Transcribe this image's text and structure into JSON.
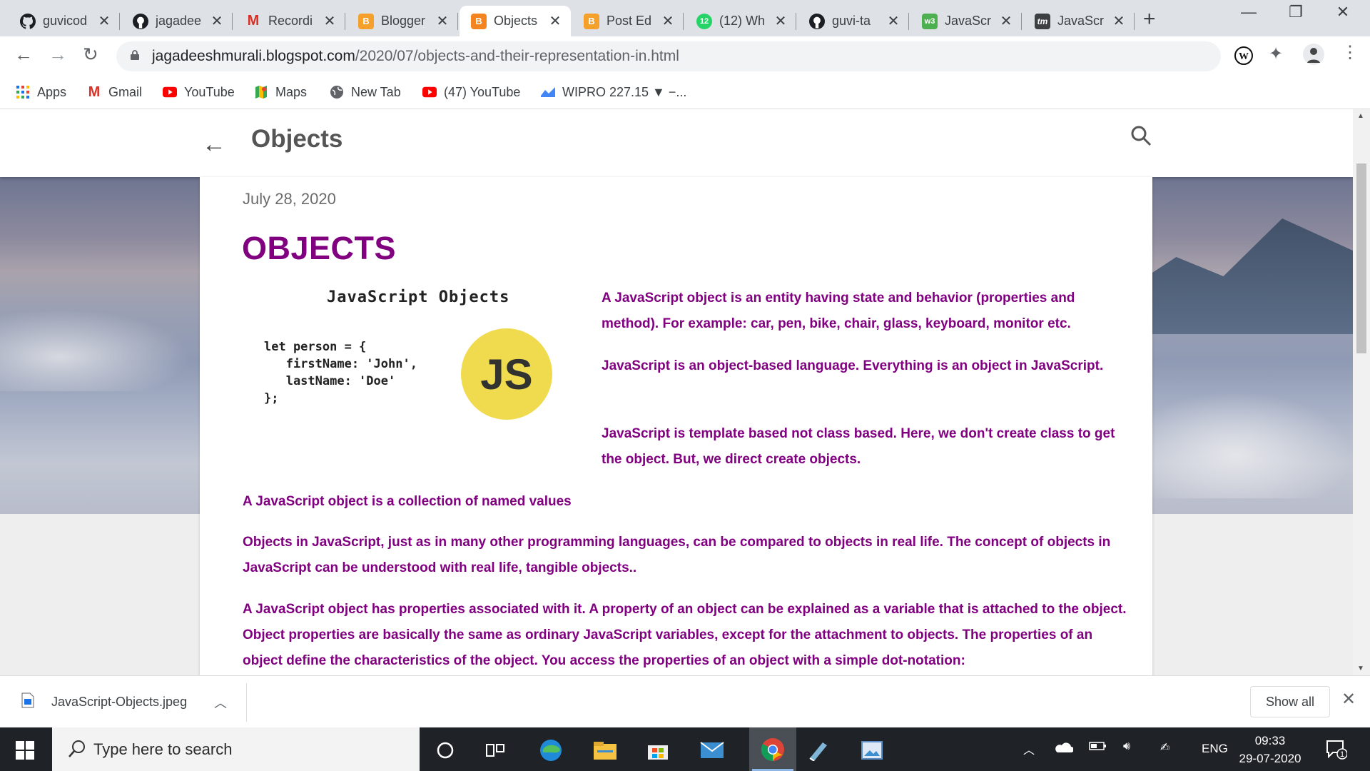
{
  "browser": {
    "tabs": [
      {
        "title": "guvicod",
        "icon": "github-icon",
        "active": false
      },
      {
        "title": "jagadee",
        "icon": "github-icon",
        "active": false
      },
      {
        "title": "Recordi",
        "icon": "gmail-icon",
        "active": false
      },
      {
        "title": "Blogger",
        "icon": "blogger-icon",
        "active": false
      },
      {
        "title": "Objects",
        "icon": "blogger-icon",
        "active": true
      },
      {
        "title": "Post Ed",
        "icon": "blogger-icon",
        "active": false
      },
      {
        "title": "(12) Wh",
        "icon": "whatsapp-icon",
        "badge": "12",
        "active": false
      },
      {
        "title": "guvi-ta",
        "icon": "github-icon",
        "active": false
      },
      {
        "title": "JavaScr",
        "icon": "w3schools-icon",
        "badge": "w3",
        "active": false
      },
      {
        "title": "JavaScr",
        "icon": "tutorialsmate-icon",
        "badge": "tm",
        "active": false
      }
    ],
    "url_domain": "jagadeeshmurali.blogspot.com",
    "url_path": "/2020/07/objects-and-their-representation-in.html",
    "bookmarks": [
      {
        "label": "Apps",
        "icon": "apps-grid-icon"
      },
      {
        "label": "Gmail",
        "icon": "gmail-icon"
      },
      {
        "label": "YouTube",
        "icon": "youtube-icon"
      },
      {
        "label": "Maps",
        "icon": "maps-icon"
      },
      {
        "label": "New Tab",
        "icon": "globe-icon"
      },
      {
        "label": "(47) YouTube",
        "icon": "youtube-icon"
      },
      {
        "label": "WIPRO 227.15 ▼ −...",
        "icon": "stock-icon"
      }
    ]
  },
  "blog": {
    "header_title": "Objects",
    "date": "July 28, 2020",
    "heading": "OBJECTS",
    "figure": {
      "title": "JavaScript Objects",
      "code": "let person = {\n   firstName: 'John',\n   lastName: 'Doe'\n};",
      "logo_text": "JS"
    },
    "paragraphs": [
      "A JavaScript object is an entity having state and behavior (properties and method). For example: car, pen, bike, chair, glass, keyboard, monitor etc.",
      "JavaScript is an object-based language. Everything is an object in JavaScript.",
      "JavaScript is template based not class based. Here, we don't create class to get the object. But, we direct create objects.",
      "A JavaScript object is a collection of named values",
      "Objects in JavaScript, just as in many other programming languages, can be compared to objects in real life. The concept of objects in JavaScript can be understood with real life, tangible objects..",
      "A JavaScript object has properties associated with it. A property of an object can be explained as a variable that is attached to the object. Object properties are basically the same as ordinary JavaScript variables, except for the attachment to objects. The properties of an object define the characteristics of the object. You access the properties of an object with a simple dot-notation:"
    ],
    "colors": {
      "accent": "#800080",
      "js_yellow": "#f0db4f"
    }
  },
  "download_bar": {
    "filename": "JavaScript-Objects.jpeg",
    "show_all": "Show all"
  },
  "taskbar": {
    "search_placeholder": "Type here to search",
    "language": "ENG",
    "time": "09:33",
    "date": "29-07-2020",
    "notification_count": "1"
  }
}
